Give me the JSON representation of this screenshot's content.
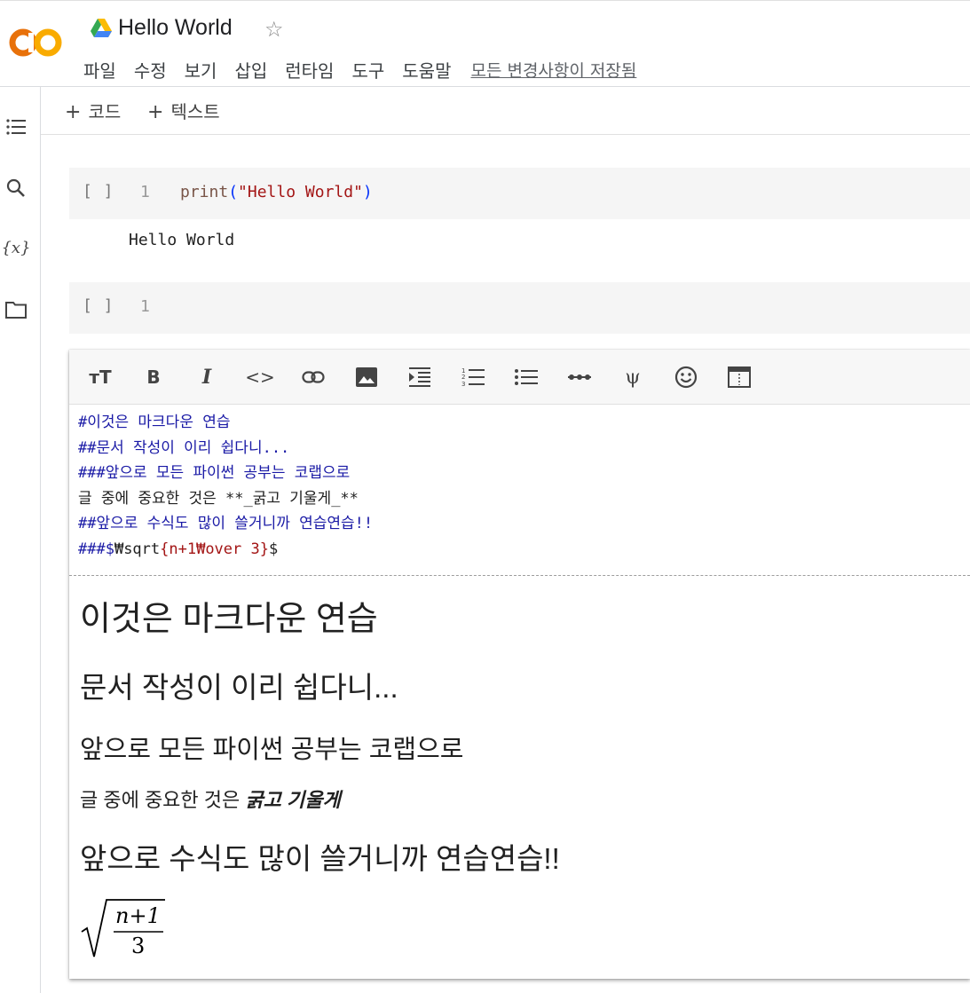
{
  "header": {
    "title": "Hello World",
    "menu": [
      "파일",
      "수정",
      "보기",
      "삽입",
      "런타임",
      "도구",
      "도움말"
    ],
    "save_status": "모든 변경사항이 저장됨",
    "logo_text": "CO"
  },
  "toolbar": {
    "add_code": "코드",
    "add_text": "텍스트"
  },
  "cells": {
    "cell1": {
      "bracket": "[ ]",
      "line": "1",
      "fn": "print",
      "arg": "\"Hello World\"",
      "output": "Hello World"
    },
    "cell2": {
      "bracket": "[ ]",
      "line": "1"
    }
  },
  "markdown_toolbar": [
    "text-size-icon",
    "bold-icon",
    "italic-icon",
    "code-icon",
    "link-icon",
    "image-icon",
    "indent-icon",
    "numbered-list-icon",
    "bulleted-list-icon",
    "horizontal-rule-icon",
    "psi-icon",
    "emoji-icon",
    "preview-layout-icon"
  ],
  "markdown_source": {
    "l1_mark": "#",
    "l1_text": "이것은 마크다운 연습",
    "l2_mark": "##",
    "l2_text": "문서 작성이 이리 쉽다니...",
    "l3_mark": "###",
    "l3_text": "앞으로 모든 파이썬 공부는 코랩으로",
    "l4": "글 중에 중요한 것은 **_굵고 기울게_**",
    "l5_mark": "##",
    "l5_text": "앞으로 수식도 많이 쓸거니까 연습연습!!",
    "l6_mark": "###$",
    "l6_cmd": "₩sqrt",
    "l6_brace": "{n+1₩over 3}",
    "l6_end": "$"
  },
  "preview": {
    "h1": "이것은 마크다운 연습",
    "h2": "문서 작성이 이리 쉽다니...",
    "h3": "앞으로 모든 파이썬 공부는 코랩으로",
    "p_prefix": "글 중에 중요한 것은 ",
    "p_bold": "굵고 기울게",
    "h2b": "앞으로 수식도 많이 쓸거니까 연습연습!!",
    "math_num": "n+1",
    "math_den": "3"
  },
  "colors": {
    "logo_orange": "#f9ab00",
    "logo_dark": "#e8710a",
    "heading_blue": "#1a1aa6"
  }
}
